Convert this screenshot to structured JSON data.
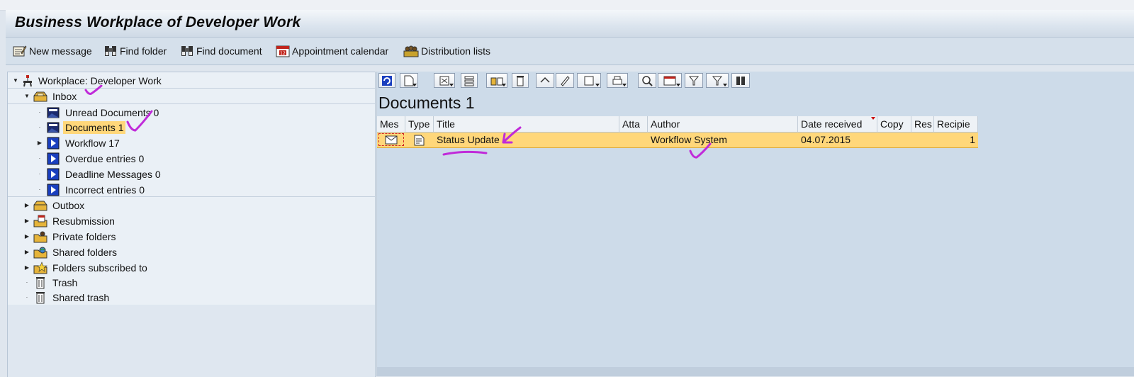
{
  "window": {
    "title": "Business Workplace of Developer Work"
  },
  "toolbar": {
    "buttons": [
      {
        "label": "New message",
        "icon": "new-message-icon"
      },
      {
        "label": "Find folder",
        "icon": "binoculars-icon"
      },
      {
        "label": "Find document",
        "icon": "binoculars-icon"
      },
      {
        "label": "Appointment calendar",
        "icon": "calendar-icon"
      },
      {
        "label": "Distribution lists",
        "icon": "distribution-lists-icon"
      }
    ]
  },
  "tree": {
    "root": "Workplace: Developer Work",
    "inbox": "Inbox",
    "inbox_items": [
      "Unread Documents 0",
      "Documents 1",
      "Workflow 17",
      "Overdue entries 0",
      "Deadline Messages 0",
      "Incorrect entries 0"
    ],
    "selected": "Documents 1",
    "folders": [
      "Outbox",
      "Resubmission",
      "Private folders",
      "Shared folders",
      "Folders subscribed to",
      "Trash",
      "Shared trash"
    ]
  },
  "documents": {
    "heading": "Documents 1",
    "columns": [
      "Mes",
      "Type",
      "Title",
      "Atta",
      "Author",
      "Date received",
      "Copy",
      "Res",
      "Recipie"
    ],
    "rows": [
      {
        "title": "Status Update",
        "author": "Workflow System",
        "date_received": "04.07.2015",
        "recipients": "1"
      }
    ]
  },
  "colors": {
    "selection": "#ffd77a",
    "annotation": "#c02bd9",
    "panel": "#cddbe9"
  }
}
